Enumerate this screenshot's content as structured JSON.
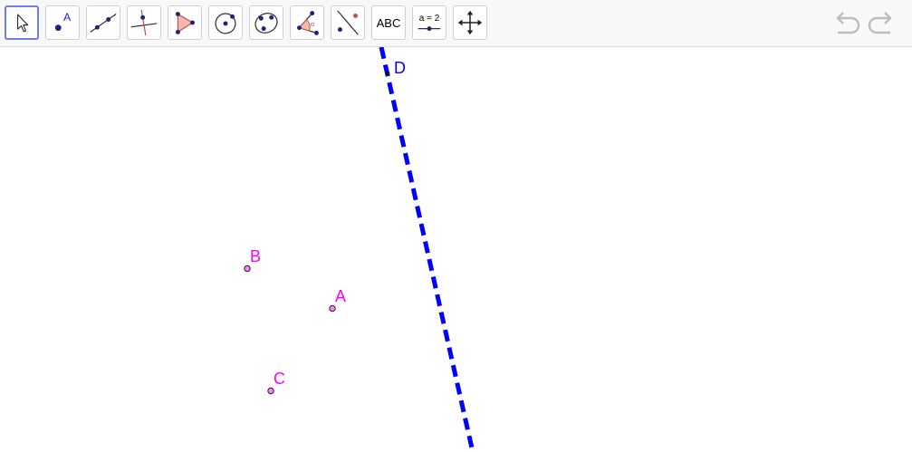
{
  "toolbar": {
    "tools": [
      {
        "name": "move-tool",
        "icon": "arrow-cursor-icon"
      },
      {
        "name": "point-tool",
        "icon": "point-icon",
        "label": "A"
      },
      {
        "name": "line-tool",
        "icon": "line-through-points-icon"
      },
      {
        "name": "perpendicular-line-tool",
        "icon": "perpendicular-line-icon"
      },
      {
        "name": "polygon-tool",
        "icon": "polygon-icon"
      },
      {
        "name": "circle-tool",
        "icon": "circle-center-point-icon"
      },
      {
        "name": "conic-tool",
        "icon": "ellipse-icon"
      },
      {
        "name": "angle-tool",
        "icon": "angle-icon",
        "label": "α"
      },
      {
        "name": "reflect-tool",
        "icon": "reflect-about-line-icon"
      },
      {
        "name": "text-tool",
        "icon": "text-icon",
        "label": "ABC"
      },
      {
        "name": "slider-tool",
        "icon": "slider-icon",
        "label": "a = 2"
      },
      {
        "name": "move-graphics-view-tool",
        "icon": "move-arrows-icon"
      }
    ],
    "selected": "move-tool",
    "undo_icon": "undo-icon",
    "redo_icon": "redo-icon"
  },
  "graphics": {
    "points": [
      {
        "label": "A",
        "color": "#ff00ff"
      },
      {
        "label": "B",
        "color": "#ff00ff"
      },
      {
        "label": "C",
        "color": "#ff00ff"
      },
      {
        "label": "D",
        "color": "#0000ff"
      }
    ],
    "line_color": "#0000ff",
    "line_style": "dashed"
  },
  "colors": {
    "selected_border": "#6d7ef0",
    "toolbar_bg": "#f8f8f8",
    "icon_red": "#c0504d",
    "polygon_fill": "#f4b8b0",
    "disabled_gray": "#bdbdbd"
  }
}
